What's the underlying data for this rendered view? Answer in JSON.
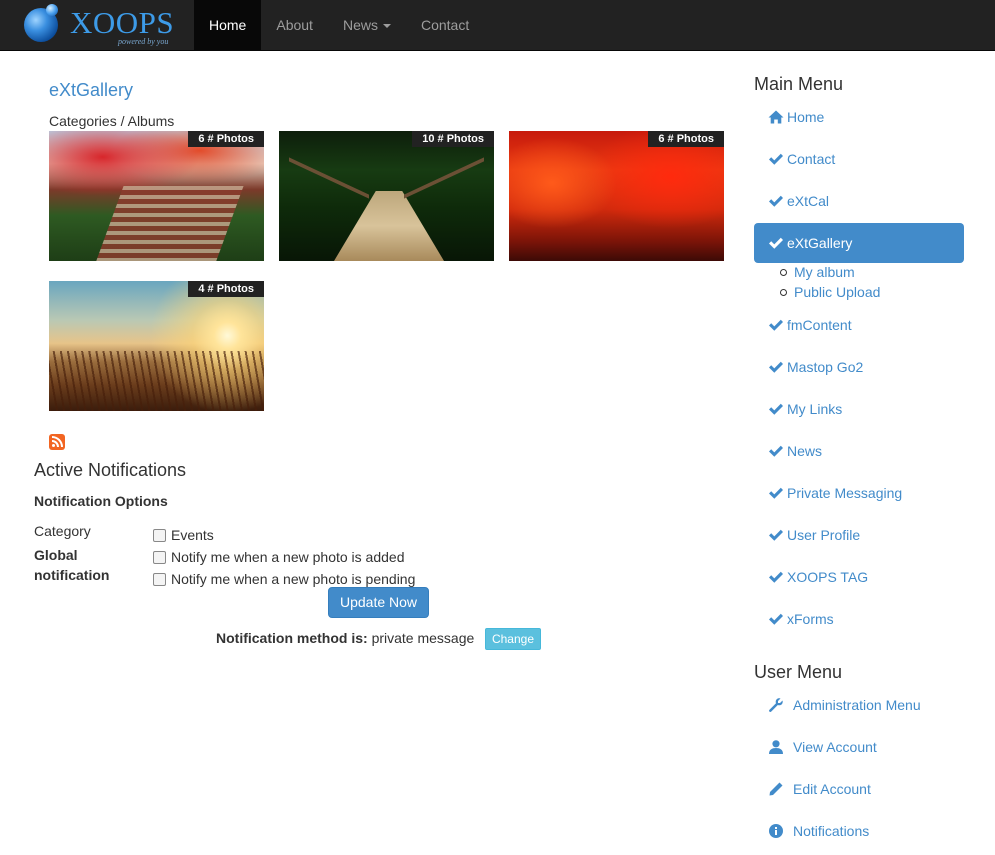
{
  "brand": {
    "name": "XOOPS",
    "tagline": "powered by you"
  },
  "nav": {
    "items": [
      {
        "label": "Home"
      },
      {
        "label": "About"
      },
      {
        "label": "News"
      },
      {
        "label": "Contact"
      }
    ]
  },
  "main": {
    "title": "eXtGallery",
    "breadcrumb": "Categories / Albums",
    "albums": [
      {
        "badge": "6 # Photos"
      },
      {
        "badge": "10 # Photos"
      },
      {
        "badge": "6 # Photos"
      },
      {
        "badge": "4 # Photos"
      }
    ],
    "notifications": {
      "heading": "Active Notifications",
      "options_heading": "Notification Options",
      "category_label": "Category",
      "global_label": "Global notification",
      "options": [
        {
          "label": "Events",
          "checked": false
        },
        {
          "label": "Notify me when a new photo is added",
          "checked": false
        },
        {
          "label": "Notify me when a new photo is pending",
          "checked": false
        }
      ],
      "update_button": "Update Now",
      "method_label": "Notification method is:",
      "method_value": "private message",
      "change_button": "Change"
    }
  },
  "sidebar": {
    "main_menu_title": "Main Menu",
    "main_menu": [
      {
        "label": "Home",
        "icon": "home-icon"
      },
      {
        "label": "Contact",
        "icon": "check-icon"
      },
      {
        "label": "eXtCal",
        "icon": "check-icon"
      },
      {
        "label": "eXtGallery",
        "icon": "check-icon",
        "active": true
      },
      {
        "label": "fmContent",
        "icon": "check-icon"
      },
      {
        "label": "Mastop Go2",
        "icon": "check-icon"
      },
      {
        "label": "My Links",
        "icon": "check-icon"
      },
      {
        "label": "News",
        "icon": "check-icon"
      },
      {
        "label": "Private Messaging",
        "icon": "check-icon"
      },
      {
        "label": "User Profile",
        "icon": "check-icon"
      },
      {
        "label": "XOOPS TAG",
        "icon": "check-icon"
      },
      {
        "label": "xForms",
        "icon": "check-icon"
      }
    ],
    "gallery_submenu": [
      {
        "label": "My album"
      },
      {
        "label": "Public Upload"
      }
    ],
    "user_menu_title": "User Menu",
    "user_menu": [
      {
        "label": "Administration Menu",
        "icon": "wrench-icon"
      },
      {
        "label": "View Account",
        "icon": "user-icon"
      },
      {
        "label": "Edit Account",
        "icon": "pencil-icon"
      },
      {
        "label": "Notifications",
        "icon": "info-icon"
      }
    ]
  },
  "colors": {
    "navbar": "#222222",
    "link": "#428bca",
    "active_menu": "#428bca",
    "info_button": "#5bc0de"
  }
}
